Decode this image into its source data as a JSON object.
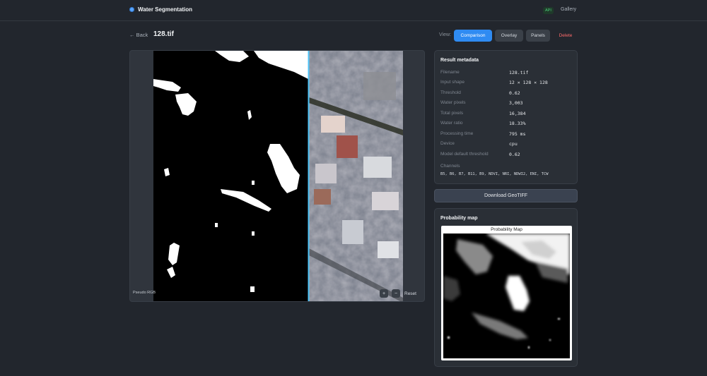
{
  "app": {
    "title": "Water Segmentation",
    "api_badge": "API",
    "gallery_link": "Gallery"
  },
  "page": {
    "back_label": "← Back",
    "title": "128.tif"
  },
  "view_switch": {
    "label": "View:",
    "options": [
      "Comparison",
      "Overlay",
      "Panels"
    ],
    "active": "Comparison",
    "delete_label": "Delete"
  },
  "viewer": {
    "left_mode": "Pseudo RGB",
    "zoom_in": "+",
    "zoom_out": "−",
    "reset": "Reset"
  },
  "metadata": {
    "title": "Result metadata",
    "rows": [
      {
        "key": "Filename",
        "value": "128.tif"
      },
      {
        "key": "Input shape",
        "value": "12 × 128 × 128"
      },
      {
        "key": "Threshold",
        "value": "0.62"
      },
      {
        "key": "Water pixels",
        "value": "3,003"
      },
      {
        "key": "Total pixels",
        "value": "16,384"
      },
      {
        "key": "Water ratio",
        "value": "18.33%"
      },
      {
        "key": "Processing time",
        "value": "795 ms"
      },
      {
        "key": "Device",
        "value": "cpu"
      },
      {
        "key": "Model default threshold",
        "value": "0.62"
      }
    ],
    "channels_label": "Channels",
    "channels_value": "B5, B6, B7, B11, B9, NDVI, NRI, NDWI2, ENI, TCW"
  },
  "download": {
    "label": "Download GeoTIFF"
  },
  "probability": {
    "title": "Probability map",
    "figure_title": "Probability Map"
  },
  "colors": {
    "accent": "#2f8bf2",
    "delete": "#ff6b6b",
    "api_badge": "#4ccf7a",
    "divider": "#4fc3f7"
  }
}
